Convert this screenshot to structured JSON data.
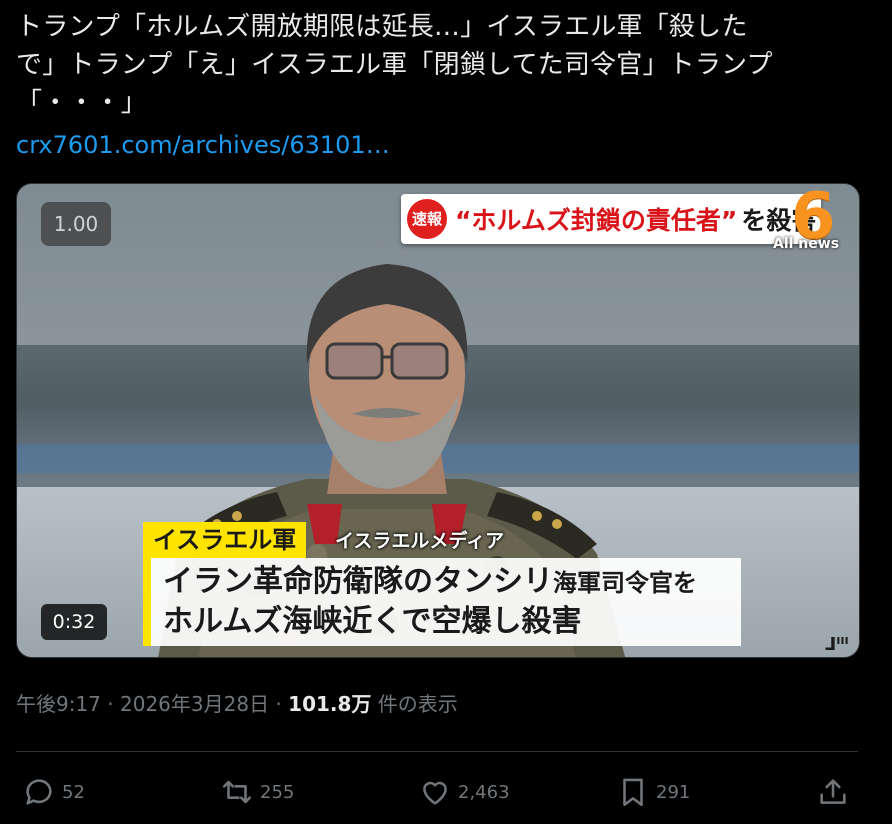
{
  "tweet": {
    "text": "トランプ「ホルムズ開放期限は延長…」イスラエル軍「殺した\nで」トランプ「え」イスラエル軍「閉鎖してた司令官」トランプ\n「・・・」",
    "link": "crx7601.com/archives/63101…"
  },
  "media": {
    "speed_label": "1.00",
    "duration": "0:32",
    "breaking_tag": "速報",
    "breaking_headline": "“ホルムズ封鎖の責任者”",
    "breaking_tail": "を殺害",
    "channel_number": "6",
    "channel_sub": "All news",
    "lower_tag": "イスラエル軍",
    "lower_source": "イスラエルメディア",
    "caption_line1_a": "イラン革命防衛隊のタンシリ",
    "caption_line1_b": "海軍司令官を",
    "caption_line2": "ホルムズ海峡近くで空爆し殺害",
    "corner_mark": "ᒧᑊᑊᑊ"
  },
  "meta": {
    "time": "午後9:17",
    "sep1": " · ",
    "date": "2026年3月28日",
    "sep2": " · ",
    "views": "101.8万",
    "views_suffix": " 件の表示"
  },
  "actions": {
    "replies": "52",
    "retweets": "255",
    "likes": "2,463",
    "bookmarks": "291"
  },
  "colors": {
    "background": "#000000",
    "text": "#e7e9ea",
    "muted": "#71767b",
    "link": "#1d9bf0",
    "breaking_red": "#d8141a",
    "caption_yellow": "#ffe400"
  }
}
